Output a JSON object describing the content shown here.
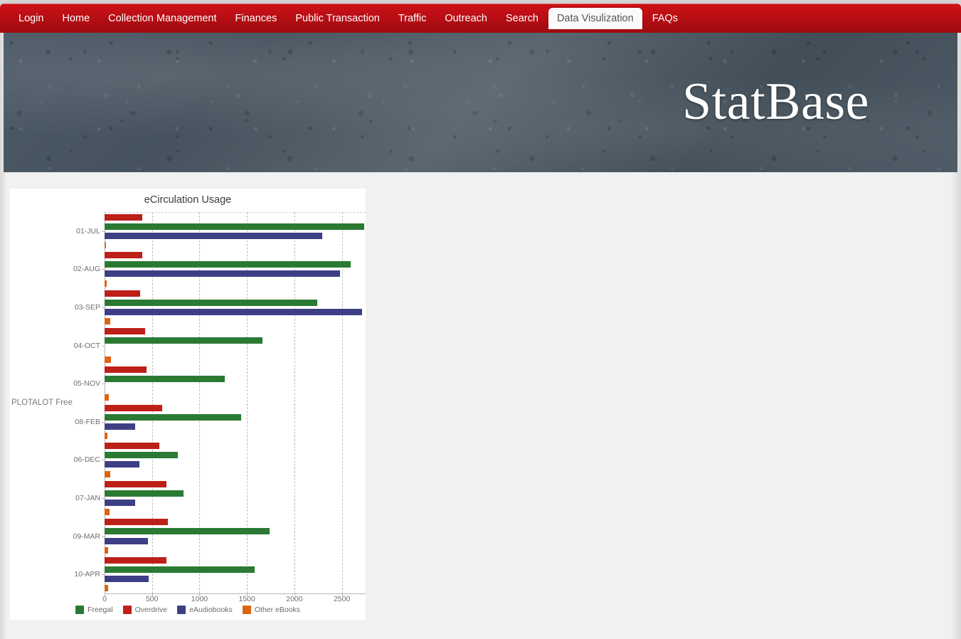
{
  "nav": {
    "items": [
      {
        "label": "Login",
        "active": false
      },
      {
        "label": "Home",
        "active": false
      },
      {
        "label": "Collection Management",
        "active": false
      },
      {
        "label": "Finances",
        "active": false
      },
      {
        "label": "Public Transaction",
        "active": false
      },
      {
        "label": "Traffic",
        "active": false
      },
      {
        "label": "Outreach",
        "active": false
      },
      {
        "label": "Search",
        "active": false
      },
      {
        "label": "Data Visulization",
        "active": true
      },
      {
        "label": "FAQs",
        "active": false
      }
    ]
  },
  "hero": {
    "title": "StatBase"
  },
  "chart_panel": {
    "watermark": "PLOTALOT Free"
  },
  "chart_data": {
    "type": "bar",
    "orientation": "horizontal",
    "title": "eCirculation Usage",
    "xlabel": "",
    "ylabel": "",
    "xlim": [
      0,
      2750
    ],
    "grid": true,
    "legend_position": "bottom",
    "ticks": [
      0,
      500,
      1000,
      1500,
      2000,
      2500
    ],
    "categories": [
      "01-JUL",
      "02-AUG",
      "03-SEP",
      "04-OCT",
      "05-NOV",
      "08-FEB",
      "06-DEC",
      "07-JAN",
      "09-MAR",
      "10-APR"
    ],
    "series": [
      {
        "name": "Freegal",
        "color": "#2a7a33",
        "values": [
          2735,
          2595,
          2240,
          1665,
          1265,
          1435,
          770,
          835,
          1740,
          1580
        ]
      },
      {
        "name": "Overdrive",
        "color": "#bd2018",
        "values": [
          395,
          400,
          375,
          430,
          440,
          605,
          575,
          650,
          670,
          650
        ]
      },
      {
        "name": "eAudiobooks",
        "color": "#3d3f85",
        "values": [
          2295,
          2480,
          2715,
          0,
          0,
          320,
          365,
          320,
          455,
          465
        ]
      },
      {
        "name": "Other eBooks",
        "color": "#dd6413",
        "values": [
          15,
          25,
          60,
          70,
          45,
          30,
          60,
          50,
          40,
          35
        ]
      }
    ]
  }
}
